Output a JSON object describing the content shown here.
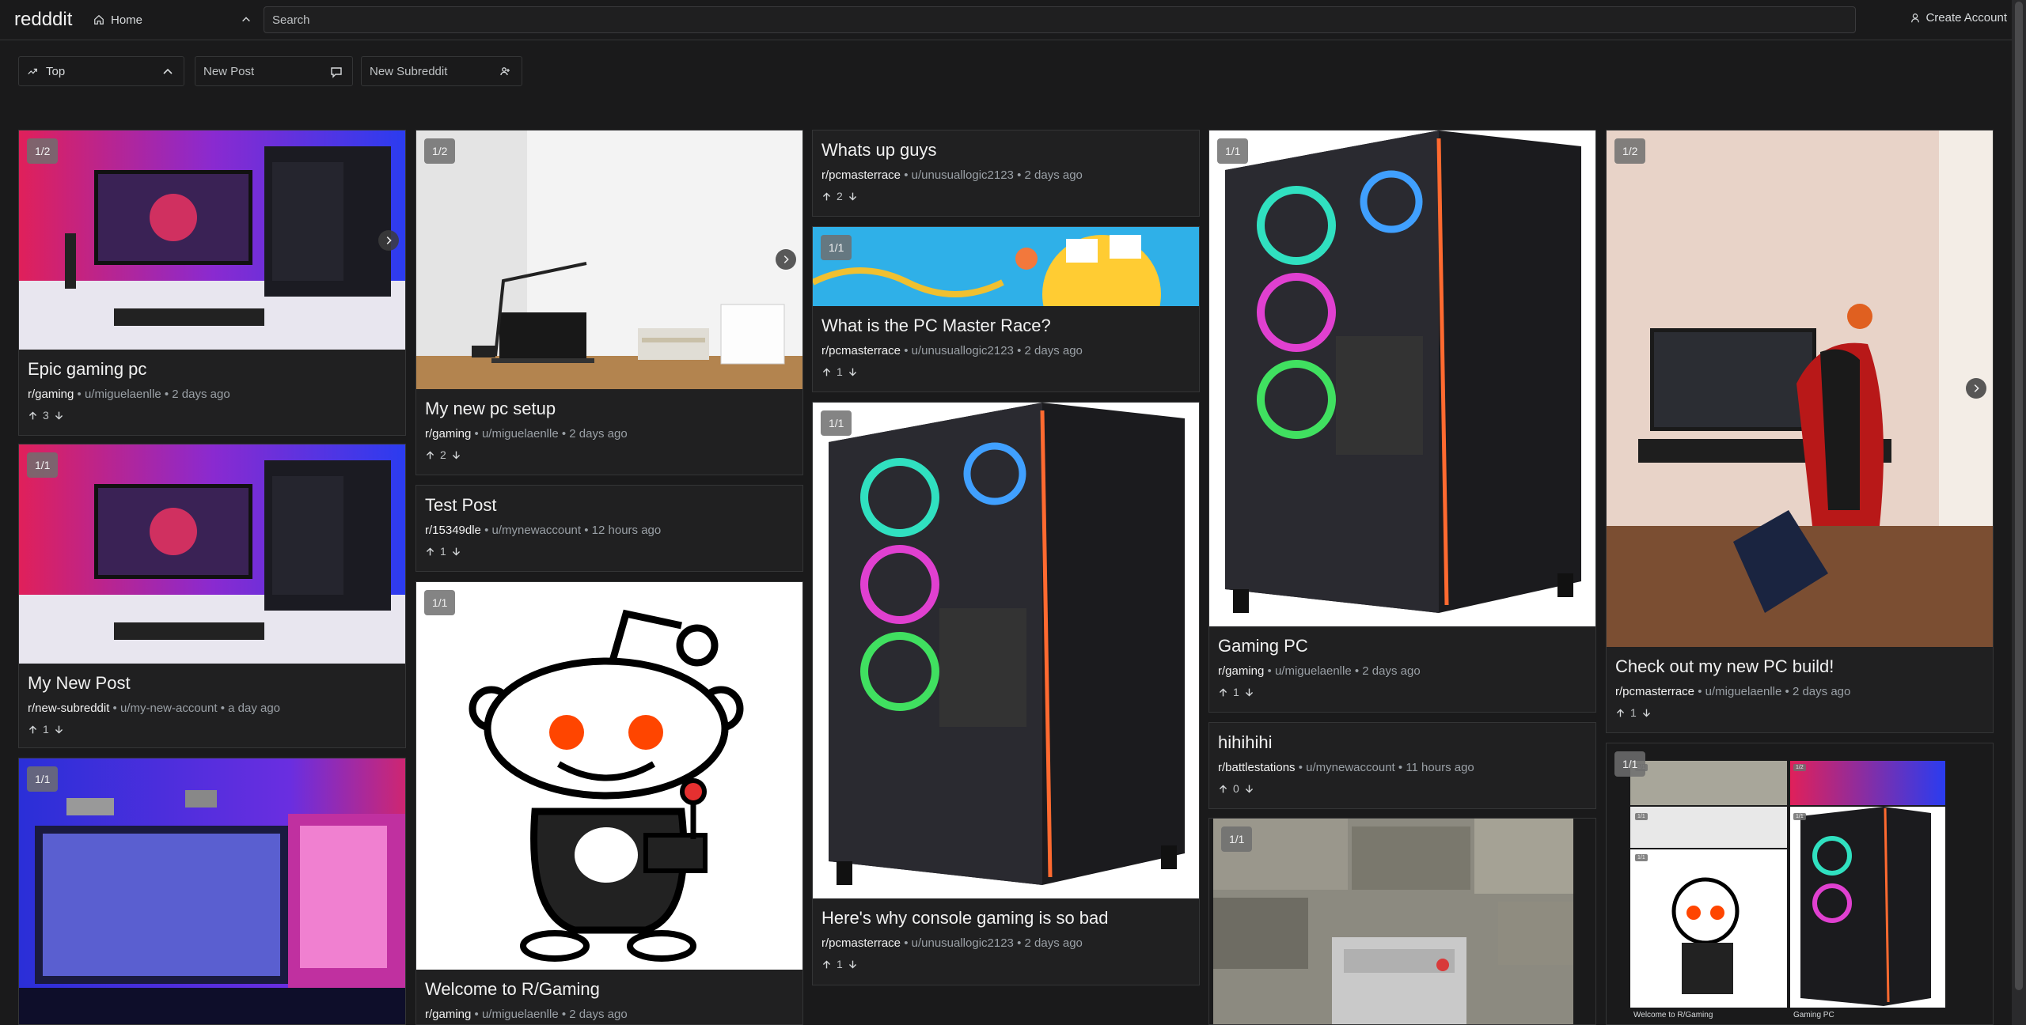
{
  "app": {
    "brand": "redddit"
  },
  "nav": {
    "home_label": "Home",
    "search_placeholder": "Search",
    "create_account": "Create Account"
  },
  "toolbar": {
    "sort_label": "Top",
    "new_post_placeholder": "New Post",
    "new_subreddit_placeholder": "New Subreddit"
  },
  "posts": [
    {
      "badge": "1/2",
      "title": "Epic gaming pc",
      "subreddit": "r/gaming",
      "user": "u/miguelaenlle",
      "time": "2 days ago",
      "votes": "3"
    },
    {
      "badge": "1/1",
      "title": "My New Post",
      "subreddit": "r/new-subreddit",
      "user": "u/my-new-account",
      "time": "a day ago",
      "votes": "1"
    },
    {
      "badge": "1/1"
    },
    {
      "badge": "1/2",
      "title": "My new pc setup",
      "subreddit": "r/gaming",
      "user": "u/miguelaenlle",
      "time": "2 days ago",
      "votes": "2"
    },
    {
      "title": "Test Post",
      "subreddit": "r/15349dle",
      "user": "u/mynewaccount",
      "time": "12 hours ago",
      "votes": "1"
    },
    {
      "badge": "1/1",
      "title": "Welcome to R/Gaming",
      "subreddit": "r/gaming",
      "user": "u/miguelaenlle",
      "time": "2 days ago"
    },
    {
      "title": "Whats up guys",
      "subreddit": "r/pcmasterrace",
      "user": "u/unusuallogic2123",
      "time": "2 days ago",
      "votes": "2"
    },
    {
      "badge": "1/1",
      "title": "What is the PC Master Race?",
      "subreddit": "r/pcmasterrace",
      "user": "u/unusuallogic2123",
      "time": "2 days ago",
      "votes": "1"
    },
    {
      "badge": "1/1",
      "title": "Here's why console gaming is so bad",
      "subreddit": "r/pcmasterrace",
      "user": "u/unusuallogic2123",
      "time": "2 days ago",
      "votes": "1"
    },
    {
      "badge": "1/1",
      "title": "Gaming PC",
      "subreddit": "r/gaming",
      "user": "u/miguelaenlle",
      "time": "2 days ago",
      "votes": "1"
    },
    {
      "title": "hihihihi",
      "subreddit": "r/battlestations",
      "user": "u/mynewaccount",
      "time": "11 hours ago",
      "votes": "0"
    },
    {
      "badge": "1/1"
    },
    {
      "badge": "1/2",
      "title": "Check out my new PC build!",
      "subreddit": "r/pcmasterrace",
      "user": "u/miguelaenlle",
      "time": "2 days ago",
      "votes": "1"
    },
    {
      "badge": "1/1",
      "thumb_caption_left": "Welcome to R/Gaming",
      "thumb_caption_right": "Gaming PC",
      "thumb_badge_a": "1/1",
      "thumb_badge_b": "1/2",
      "thumb_badge_c": "1/1",
      "thumb_badge_d": "1/1",
      "thumb_badge_e": "1/1"
    }
  ]
}
